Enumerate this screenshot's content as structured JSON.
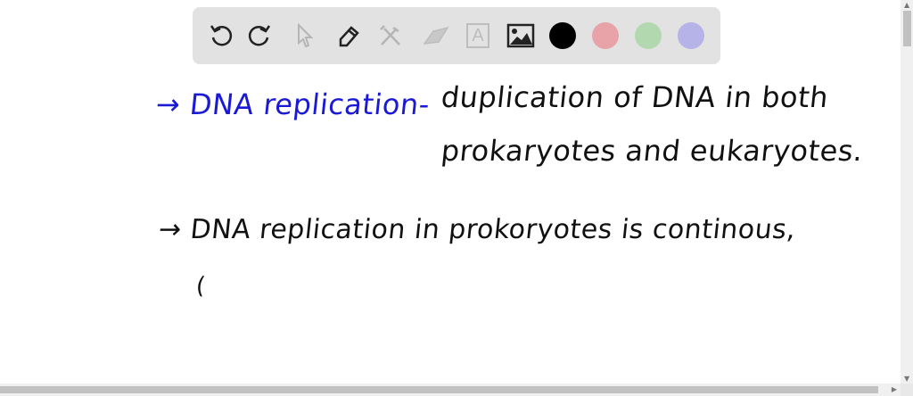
{
  "toolbar": {
    "tools": [
      {
        "name": "undo-icon",
        "enabled": true
      },
      {
        "name": "redo-icon",
        "enabled": true
      },
      {
        "name": "select-pointer-icon",
        "enabled": false
      },
      {
        "name": "pen-icon",
        "enabled": true
      },
      {
        "name": "tools-icon",
        "enabled": false
      },
      {
        "name": "eraser-icon",
        "enabled": false
      },
      {
        "name": "text-icon",
        "enabled": false
      },
      {
        "name": "image-icon",
        "enabled": true
      }
    ],
    "text_tool_glyph": "A",
    "colors": [
      "#000000",
      "#e8a3a8",
      "#b2d8b0",
      "#b5b3e8"
    ]
  },
  "canvas": {
    "line1_term": "→ DNA replication-",
    "line1_def": "duplication of DNA in both",
    "line2": "prokaryotes and eukaryotes.",
    "line3": "→ DNA replication in prokoryotes is continous,",
    "line4": "("
  },
  "colors": {
    "blue_ink": "#1a1ad6",
    "black_ink": "#111111"
  }
}
